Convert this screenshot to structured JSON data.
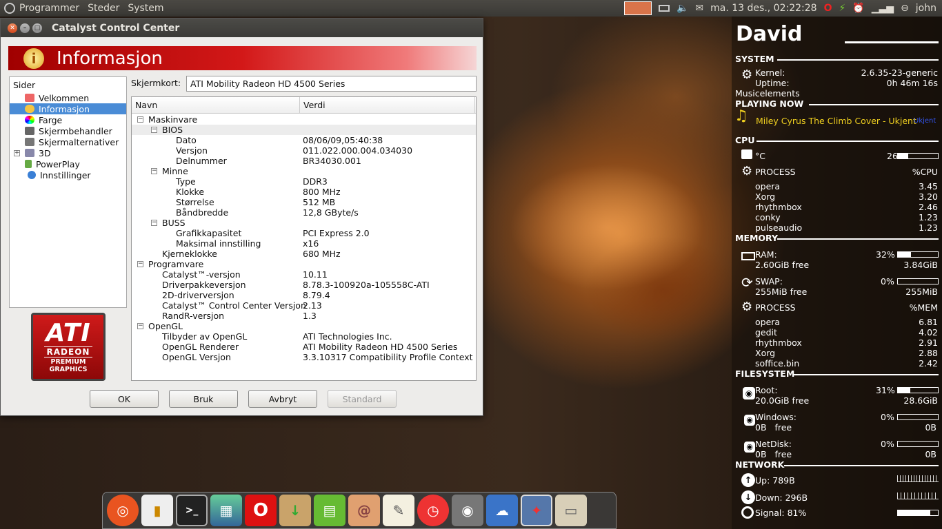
{
  "topbar": {
    "menus": [
      "Programmer",
      "Steder",
      "System"
    ],
    "clock": "ma. 13 des., 02:22:28",
    "user": "john"
  },
  "window": {
    "title": "Catalyst Control Center",
    "header": "Informasjon",
    "sidebar": {
      "title": "Sider",
      "items": [
        "Velkommen",
        "Informasjon",
        "Farge",
        "Skjermbehandler",
        "Skjermalternativer",
        "3D",
        "PowerPlay",
        "Innstillinger"
      ]
    },
    "logo": {
      "brand": "ATI",
      "product": "RADEON",
      "tagline1": "PREMIUM",
      "tagline2": "GRAPHICS"
    },
    "skjermkort_label": "Skjermkort:",
    "skjermkort_value": "ATI Mobility Radeon HD 4500 Series",
    "columns": [
      "Navn",
      "Verdi"
    ],
    "rows": [
      {
        "k": "Maskinvare",
        "v": ""
      },
      {
        "k": "BIOS",
        "v": ""
      },
      {
        "k": "Dato",
        "v": "08/06/09,05:40:38"
      },
      {
        "k": "Versjon",
        "v": "011.022.000.004.034030"
      },
      {
        "k": "Delnummer",
        "v": "BR34030.001"
      },
      {
        "k": "Minne",
        "v": ""
      },
      {
        "k": "Type",
        "v": "DDR3"
      },
      {
        "k": "Klokke",
        "v": "800 MHz"
      },
      {
        "k": "Størrelse",
        "v": "512 MB"
      },
      {
        "k": "Båndbredde",
        "v": "12,8 GByte/s"
      },
      {
        "k": "BUSS",
        "v": ""
      },
      {
        "k": "Grafikkapasitet",
        "v": "PCI Express 2.0"
      },
      {
        "k": "Maksimal innstilling",
        "v": "x16"
      },
      {
        "k": "Kjerneklokke",
        "v": "680 MHz"
      },
      {
        "k": "Programvare",
        "v": ""
      },
      {
        "k": "Catalyst™-versjon",
        "v": "10.11"
      },
      {
        "k": "Driverpakkeversjon",
        "v": "8.78.3-100920a-105558C-ATI"
      },
      {
        "k": "2D-driverversjon",
        "v": "8.79.4"
      },
      {
        "k": "Catalyst™ Control Center Versjon",
        "v": "2.13"
      },
      {
        "k": "RandR-versjon",
        "v": "1.3"
      },
      {
        "k": "OpenGL",
        "v": ""
      },
      {
        "k": "Tilbyder av OpenGL",
        "v": "ATI Technologies Inc."
      },
      {
        "k": "OpenGL Renderer",
        "v": "ATI Mobility Radeon HD 4500 Series"
      },
      {
        "k": "OpenGL Versjon",
        "v": "3.3.10317 Compatibility Profile Context"
      }
    ],
    "buttons": {
      "ok": "OK",
      "apply": "Bruk",
      "cancel": "Avbryt",
      "default": "Standard"
    }
  },
  "conky": {
    "name": "David",
    "system": {
      "title": "SYSTEM",
      "kernel_label": "Kernel:",
      "kernel": "2.6.35-23-generic",
      "uptime_label": "Uptime:",
      "uptime": "0h 46m 16s",
      "music_label": "Musicelements"
    },
    "playing": {
      "title": "PLAYING NOW",
      "track": "Miley Cyrus The Climb Cover - Ukjent",
      "tag": "Ukjent"
    },
    "cpu": {
      "title": "CPU",
      "temp_label": "°C",
      "percent": "26%",
      "level": 26,
      "proc_label": "PROCESS",
      "proc_col": "%CPU",
      "procs": [
        {
          "n": "opera",
          "v": "3.45"
        },
        {
          "n": "Xorg",
          "v": "3.20"
        },
        {
          "n": "rhythmbox",
          "v": "2.46"
        },
        {
          "n": "conky",
          "v": "1.23"
        },
        {
          "n": "pulseaudio",
          "v": "1.23"
        }
      ]
    },
    "memory": {
      "title": "MEMORY",
      "ram_label": "RAM:",
      "ram_percent": "32%",
      "ram_level": 32,
      "ram_free": "2.60GiB free",
      "ram_total": "3.84GiB",
      "swap_label": "SWAP:",
      "swap_percent": "0%",
      "swap_level": 0,
      "swap_free": "255MiB free",
      "swap_total": "255MiB",
      "proc_label": "PROCESS",
      "proc_col": "%MEM",
      "procs": [
        {
          "n": "opera",
          "v": "6.81"
        },
        {
          "n": "gedit",
          "v": "4.02"
        },
        {
          "n": "rhythmbox",
          "v": "2.91"
        },
        {
          "n": "Xorg",
          "v": "2.88"
        },
        {
          "n": "soffice.bin",
          "v": "2.42"
        }
      ]
    },
    "filesystem": {
      "title": "FILESYSTEM",
      "root_label": "Root:",
      "root_percent": "31%",
      "root_level": 31,
      "root_free": "20.0GiB free",
      "root_total": "28.6GiB",
      "win_label": "Windows:",
      "win_percent": "0%",
      "win_level": 0,
      "win_free": "0B   free",
      "win_total": "0B",
      "net_label": "NetDisk:",
      "net_percent": "0%",
      "net_level": 0,
      "net_free": "0B   free",
      "net_total": "0B"
    },
    "network": {
      "title": "NETWORK",
      "up": "Up: 789B",
      "down": "Down: 296B",
      "signal": "Signal: 81%",
      "signal_level": 81
    }
  },
  "dock": {
    "icons": [
      "ubuntu-icon",
      "bookmark-icon",
      "terminal-icon",
      "image-viewer-icon",
      "opera-icon",
      "archive-icon",
      "notes-icon",
      "shell-icon",
      "text-editor-icon",
      "alarm-clock-icon",
      "speaker-icon",
      "weather-icon",
      "network-icon",
      "folder-icon"
    ]
  }
}
